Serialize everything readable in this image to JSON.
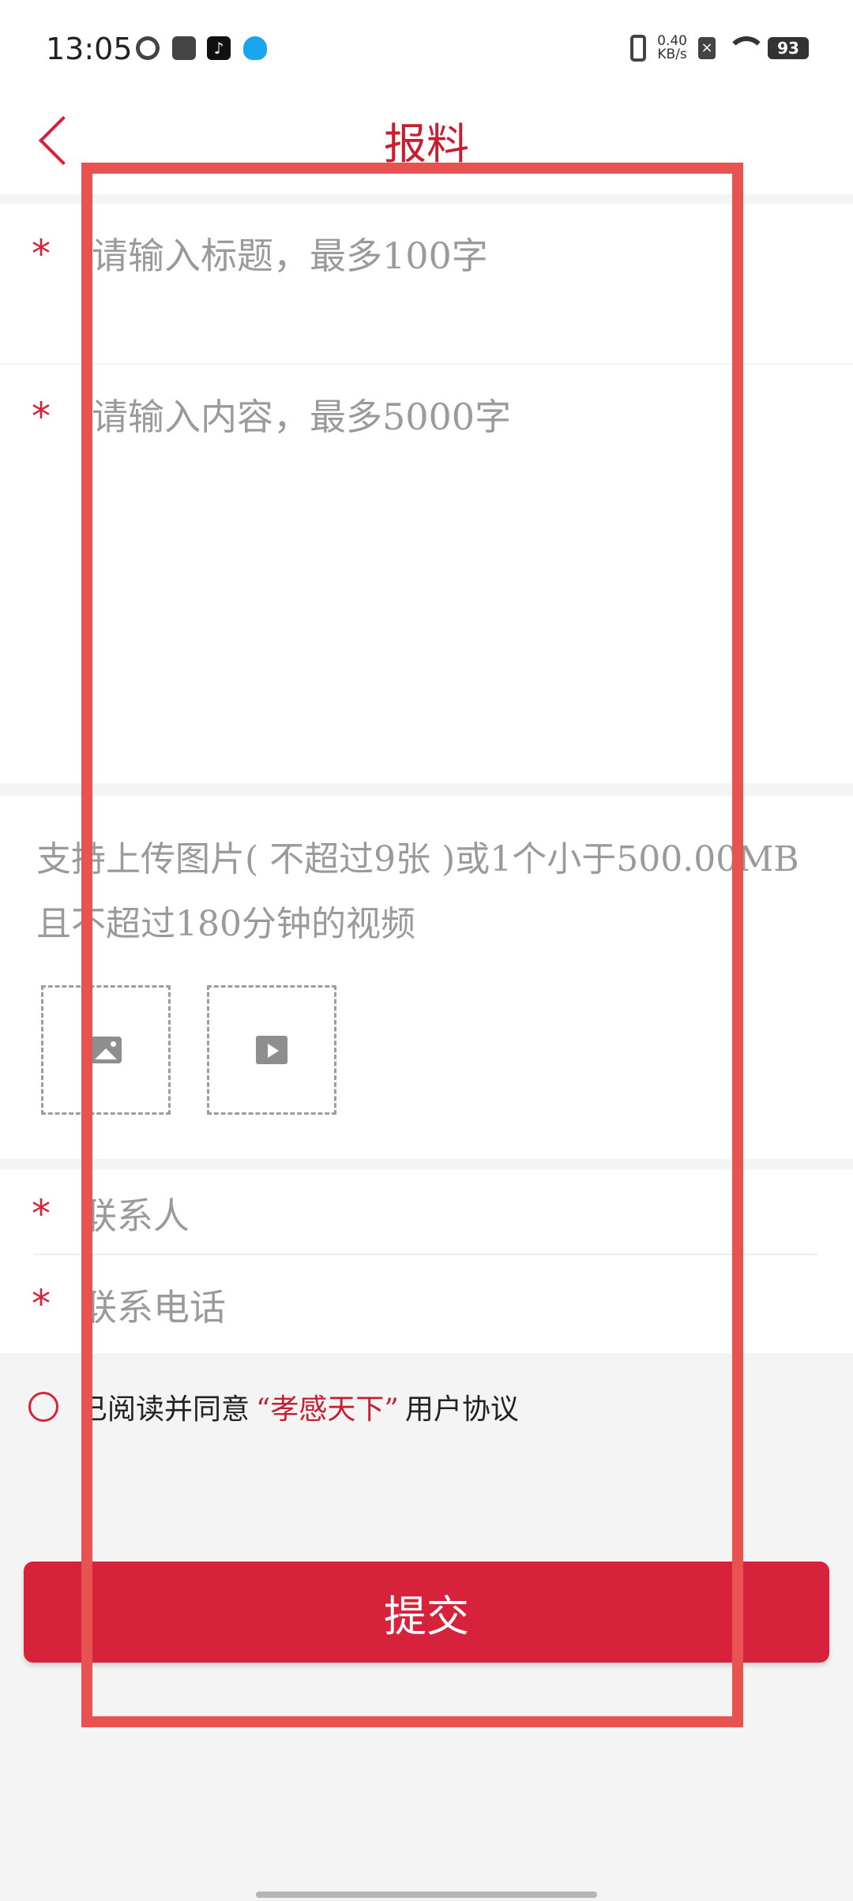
{
  "status_bar": {
    "time": "13:05",
    "net_speed_value": "0.40",
    "net_speed_unit": "KB/s",
    "battery": "93",
    "icons": [
      "app-icon",
      "mail-icon",
      "tiktok-icon",
      "qq-icon",
      "vibrate-icon",
      "close-notification-icon",
      "wifi-icon",
      "battery-icon"
    ]
  },
  "header": {
    "title": "报料",
    "back_icon": "chevron-left-icon"
  },
  "form": {
    "title_placeholder": "请输入标题，最多100字",
    "content_placeholder": "请输入内容，最多5000字",
    "required_mark": "*",
    "upload_note": "支持上传图片( 不超过9张 )或1个小于500.00MB且不超过180分钟的视频",
    "upload_image_icon": "image-icon",
    "upload_video_icon": "video-icon",
    "contact_name_placeholder": "联系人",
    "contact_phone_placeholder": "联系电话"
  },
  "agreement": {
    "prefix": "已阅读并同意",
    "link": "“孝感天下”",
    "suffix": "用户协议"
  },
  "submit": {
    "label": "提交"
  },
  "colors": {
    "accent": "#d6223a",
    "title": "#c81e32",
    "placeholder": "#9a9a9a",
    "highlight": "#e85250"
  }
}
